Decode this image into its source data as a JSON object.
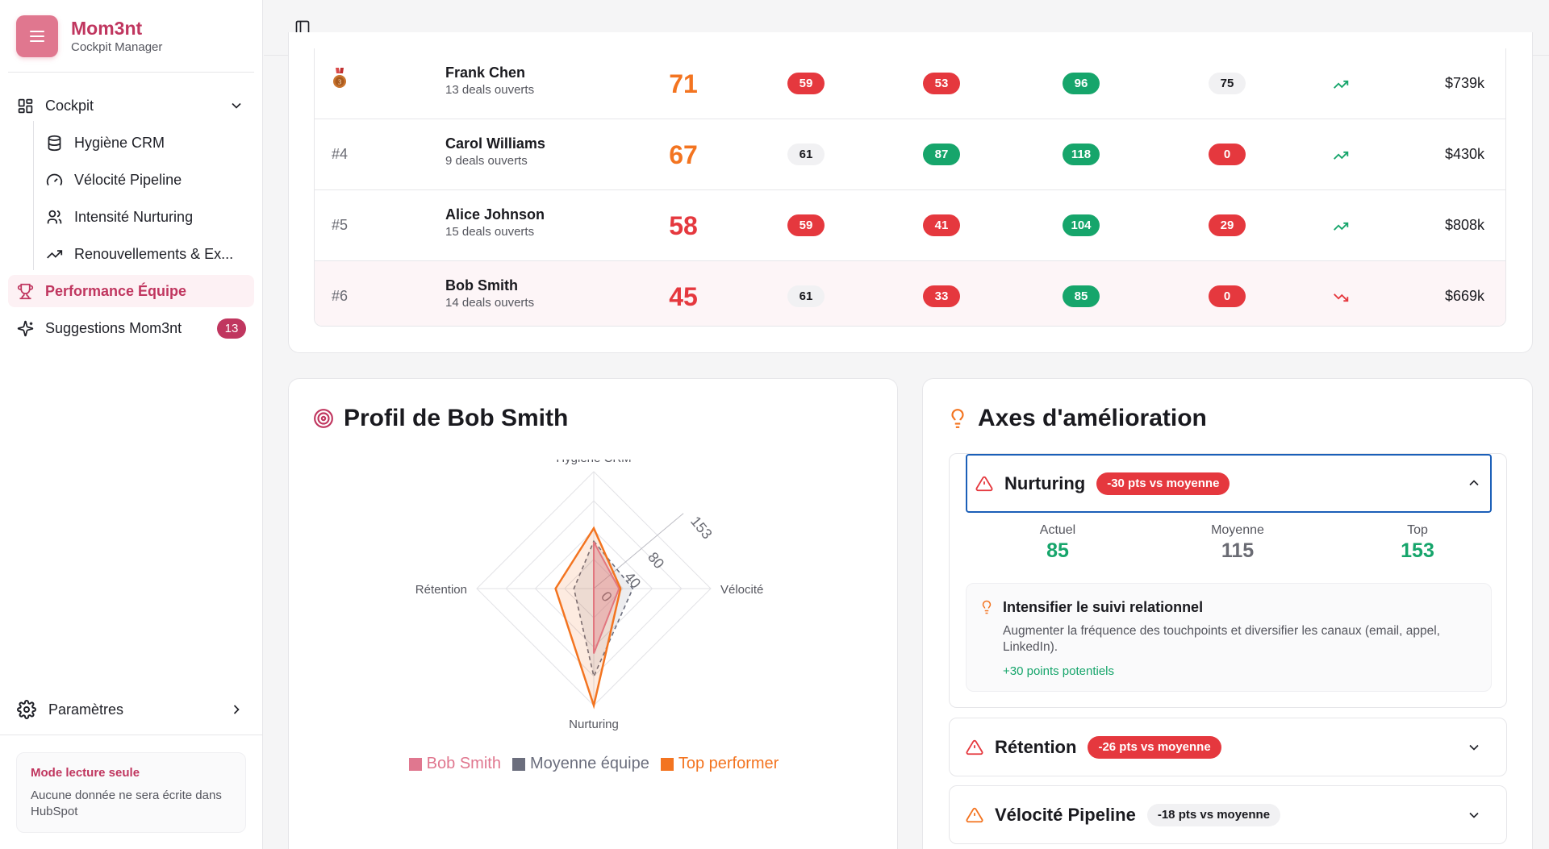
{
  "brand": {
    "title": "Mom3nt",
    "subtitle": "Cockpit Manager"
  },
  "nav": {
    "cockpit": "Cockpit",
    "items": [
      {
        "label": "Hygiène CRM",
        "icon": "database-icon"
      },
      {
        "label": "Vélocité Pipeline",
        "icon": "gauge-icon"
      },
      {
        "label": "Intensité Nurturing",
        "icon": "users-icon"
      },
      {
        "label": "Renouvellements & Ex...",
        "icon": "trending-up-icon"
      }
    ],
    "performance": "Performance Équipe",
    "suggestions": "Suggestions Mom3nt",
    "suggestions_count": "13",
    "settings": "Paramètres"
  },
  "readonly": {
    "title": "Mode lecture seule",
    "text": "Aucune donnée ne sera écrite dans HubSpot"
  },
  "colors": {
    "red": "#e5383e",
    "green": "#16a56b",
    "orange": "#f37420",
    "brand": "#c0365f",
    "pink": "#e0778f"
  },
  "ranking": [
    {
      "rank": "",
      "medal": true,
      "name": "Frank Chen",
      "deals": "13 deals ouverts",
      "score": "71",
      "score_color": "#f37420",
      "hygiene": "59",
      "hygiene_c": "red",
      "velocity": "53",
      "velocity_c": "red",
      "nurturing": "96",
      "nurturing_c": "green",
      "retention": "75",
      "retention_c": "gray",
      "trend": "up",
      "amount": "$739k"
    },
    {
      "rank": "#4",
      "medal": false,
      "name": "Carol Williams",
      "deals": "9 deals ouverts",
      "score": "67",
      "score_color": "#f37420",
      "hygiene": "61",
      "hygiene_c": "gray",
      "velocity": "87",
      "velocity_c": "green",
      "nurturing": "118",
      "nurturing_c": "green",
      "retention": "0",
      "retention_c": "red",
      "trend": "up",
      "amount": "$430k"
    },
    {
      "rank": "#5",
      "medal": false,
      "name": "Alice Johnson",
      "deals": "15 deals ouverts",
      "score": "58",
      "score_color": "#e5383e",
      "hygiene": "59",
      "hygiene_c": "red",
      "velocity": "41",
      "velocity_c": "red",
      "nurturing": "104",
      "nurturing_c": "green",
      "retention": "29",
      "retention_c": "red",
      "trend": "up",
      "amount": "$808k"
    },
    {
      "rank": "#6",
      "medal": false,
      "name": "Bob Smith",
      "deals": "14 deals ouverts",
      "score": "45",
      "score_color": "#e5383e",
      "hygiene": "61",
      "hygiene_c": "gray",
      "velocity": "33",
      "velocity_c": "red",
      "nurturing": "85",
      "nurturing_c": "green",
      "retention": "0",
      "retention_c": "red",
      "trend": "down",
      "amount": "$669k",
      "highlight": true
    }
  ],
  "profile": {
    "title": "Profil de Bob Smith"
  },
  "chart_data": {
    "type": "radar",
    "axes": [
      "Hygiène CRM",
      "Vélocité",
      "Nurturing",
      "Rétention"
    ],
    "ticks": [
      "0",
      "40",
      "80",
      "153"
    ],
    "max": 153,
    "series": [
      {
        "name": "Bob Smith",
        "values": [
          61,
          33,
          85,
          0
        ],
        "color": "#e0778f"
      },
      {
        "name": "Moyenne équipe",
        "values": [
          62,
          51,
          115,
          26
        ],
        "color": "#6b6e7d"
      },
      {
        "name": "Top performer",
        "values": [
          79,
          35,
          153,
          50
        ],
        "color": "#f37420"
      }
    ]
  },
  "axes": {
    "title": "Axes d'amélioration",
    "open": {
      "title": "Nurturing",
      "tag": "-30 pts vs moyenne",
      "stats": [
        {
          "label": "Actuel",
          "value": "85",
          "color": "#16a56b"
        },
        {
          "label": "Moyenne",
          "value": "115",
          "color": "#6a6b73"
        },
        {
          "label": "Top",
          "value": "153",
          "color": "#16a56b"
        }
      ],
      "tip_title": "Intensifier le suivi relationnel",
      "tip_desc": "Augmenter la fréquence des touchpoints et diversifier les canaux (email, appel, LinkedIn).",
      "tip_gain": "+30 points potentiels"
    },
    "closed": [
      {
        "title": "Rétention",
        "tag": "-26 pts vs moyenne",
        "tag_c": "red",
        "warn": "#e5383e"
      },
      {
        "title": "Vélocité Pipeline",
        "tag": "-18 pts vs moyenne",
        "tag_c": "gray",
        "warn": "#f37420"
      }
    ]
  }
}
